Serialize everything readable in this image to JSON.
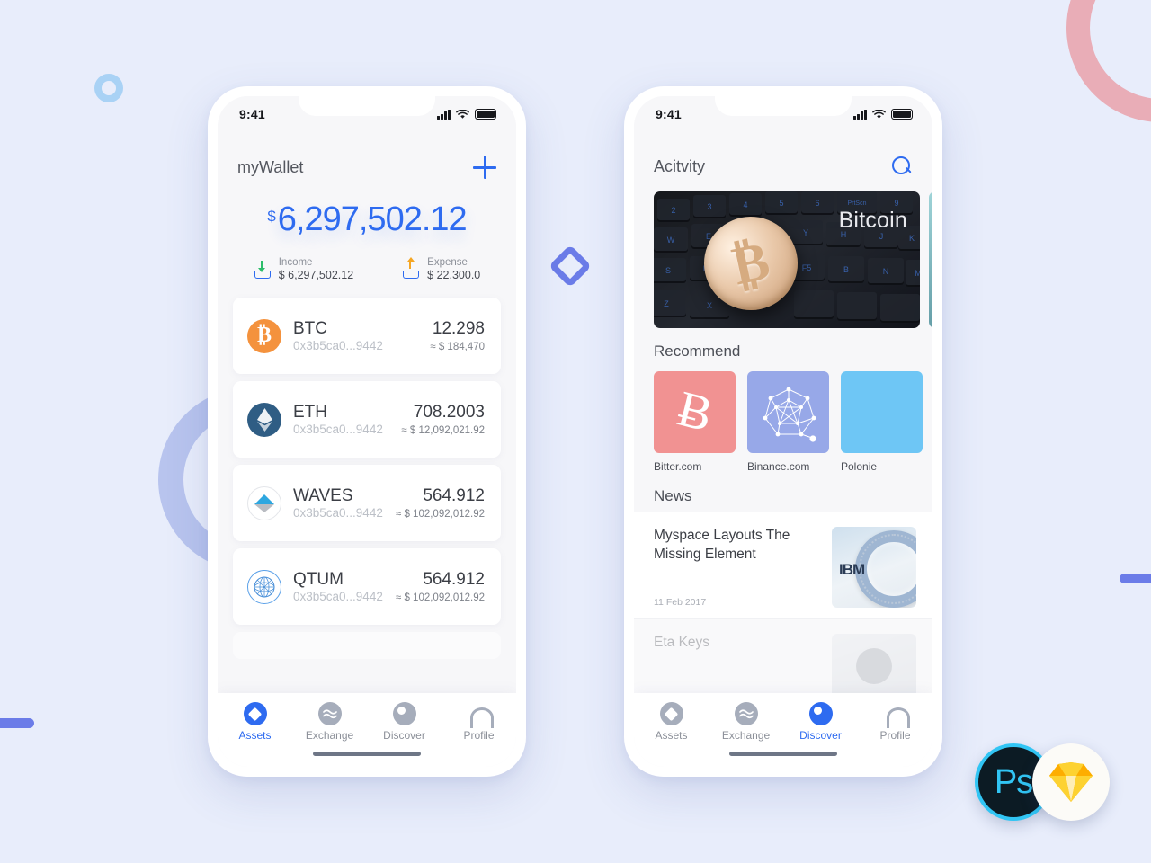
{
  "canvas": {
    "background_color": "#e8edfb",
    "accent_blue": "#2e6bf0",
    "periwinkle": "#6b7ce8",
    "pink": "#e9aab3"
  },
  "decorations": [
    {
      "name": "ring-pink",
      "color": "#e9aab3"
    },
    {
      "name": "ring-periwinkle",
      "color": "#b8c4ee"
    },
    {
      "name": "ring-small-blue",
      "color": "#a9d2f5"
    },
    {
      "name": "diamond-outline",
      "color": "#6b7ce8"
    },
    {
      "name": "bar-left",
      "color": "#6b7ce8"
    },
    {
      "name": "bar-right",
      "color": "#6b7ce8"
    }
  ],
  "wallet_screen": {
    "status": {
      "time": "9:41",
      "signal": "signal-bars-icon",
      "wifi": "wifi-icon",
      "battery": "battery-full-icon"
    },
    "header": {
      "title": "myWallet",
      "add_icon": "plus-icon"
    },
    "balance": {
      "currency_symbol": "$",
      "amount": "6,297,502.12"
    },
    "summary": [
      {
        "label": "Income",
        "value": "$ 6,297,502.12",
        "icon": "income-arrow-down-icon",
        "color": "#2cbd6a"
      },
      {
        "label": "Expense",
        "value": "$ 22,300.0",
        "icon": "expense-arrow-up-icon",
        "color": "#f5a623"
      }
    ],
    "assets": [
      {
        "symbol": "BTC",
        "address": "0x3b5ca0...9442",
        "amount": "12.298",
        "fiat": "≈ $ 184,470",
        "icon": "bitcoin-icon"
      },
      {
        "symbol": "ETH",
        "address": "0x3b5ca0...9442",
        "amount": "708.2003",
        "fiat": "≈ $ 12,092,021.92",
        "icon": "ethereum-icon"
      },
      {
        "symbol": "WAVES",
        "address": "0x3b5ca0...9442",
        "amount": "564.912",
        "fiat": "≈ $ 102,092,012.92",
        "icon": "waves-icon"
      },
      {
        "symbol": "QTUM",
        "address": "0x3b5ca0...9442",
        "amount": "564.912",
        "fiat": "≈ $ 102,092,012.92",
        "icon": "qtum-icon"
      }
    ],
    "tabs": [
      {
        "label": "Assets",
        "icon": "assets-diamond-icon",
        "active": true
      },
      {
        "label": "Exchange",
        "icon": "exchange-waves-icon",
        "active": false
      },
      {
        "label": "Discover",
        "icon": "discover-compass-icon",
        "active": false
      },
      {
        "label": "Profile",
        "icon": "profile-person-icon",
        "active": false
      }
    ]
  },
  "discover_screen": {
    "status": {
      "time": "9:41",
      "signal": "signal-bars-icon",
      "wifi": "wifi-icon",
      "battery": "battery-full-icon"
    },
    "header": {
      "title": "Acitvity",
      "search_icon": "search-icon"
    },
    "banner": {
      "caption": "Bitcoin",
      "image": "bitcoin-coin-on-keyboard"
    },
    "recommend": {
      "section_title": "Recommend",
      "items": [
        {
          "label": "Bitter.com",
          "color": "#f19292",
          "icon": "bitcoin-b-icon"
        },
        {
          "label": "Binance.com",
          "color": "#97a8e8",
          "icon": "network-polyhedron-icon"
        },
        {
          "label": "Polonie",
          "color": "#6ec6f5",
          "icon": "placeholder-icon"
        }
      ]
    },
    "news": {
      "section_title": "News",
      "items": [
        {
          "title": "Myspace Layouts The Missing Element",
          "date": "11 Feb 2017",
          "thumb": "ibm-server-ring-image"
        },
        {
          "title": "Eta Keys",
          "date": "",
          "thumb": "avatar-image"
        }
      ]
    },
    "tabs": [
      {
        "label": "Assets",
        "icon": "assets-diamond-icon",
        "active": false
      },
      {
        "label": "Exchange",
        "icon": "exchange-waves-icon",
        "active": false
      },
      {
        "label": "Discover",
        "icon": "discover-compass-icon",
        "active": true
      },
      {
        "label": "Profile",
        "icon": "profile-person-icon",
        "active": false
      }
    ]
  },
  "badges": [
    {
      "name": "photoshop-badge",
      "label": "Ps",
      "color": "#31c5f4"
    },
    {
      "name": "sketch-badge",
      "label": "",
      "color": "#f7b500"
    }
  ]
}
